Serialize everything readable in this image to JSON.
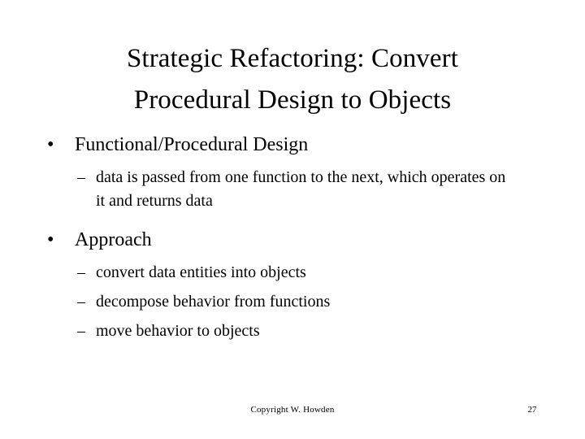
{
  "slide": {
    "background_color": "#ffffff",
    "text_color": "#000000",
    "title": {
      "line1": "Strategic Refactoring: Convert",
      "line2": "Procedural Design to Objects"
    },
    "bullet_marker": "•",
    "dash_marker": "–",
    "groups": [
      {
        "heading": "Functional/Procedural Design",
        "items": [
          "data is passed from one function to the next, which operates on it and returns data"
        ]
      },
      {
        "heading": "Approach",
        "items": [
          "convert data entities into objects",
          "decompose behavior from functions",
          "move behavior to objects"
        ]
      }
    ],
    "footer": {
      "copyright": "Copyright W. Howden",
      "page_number": "27"
    }
  }
}
